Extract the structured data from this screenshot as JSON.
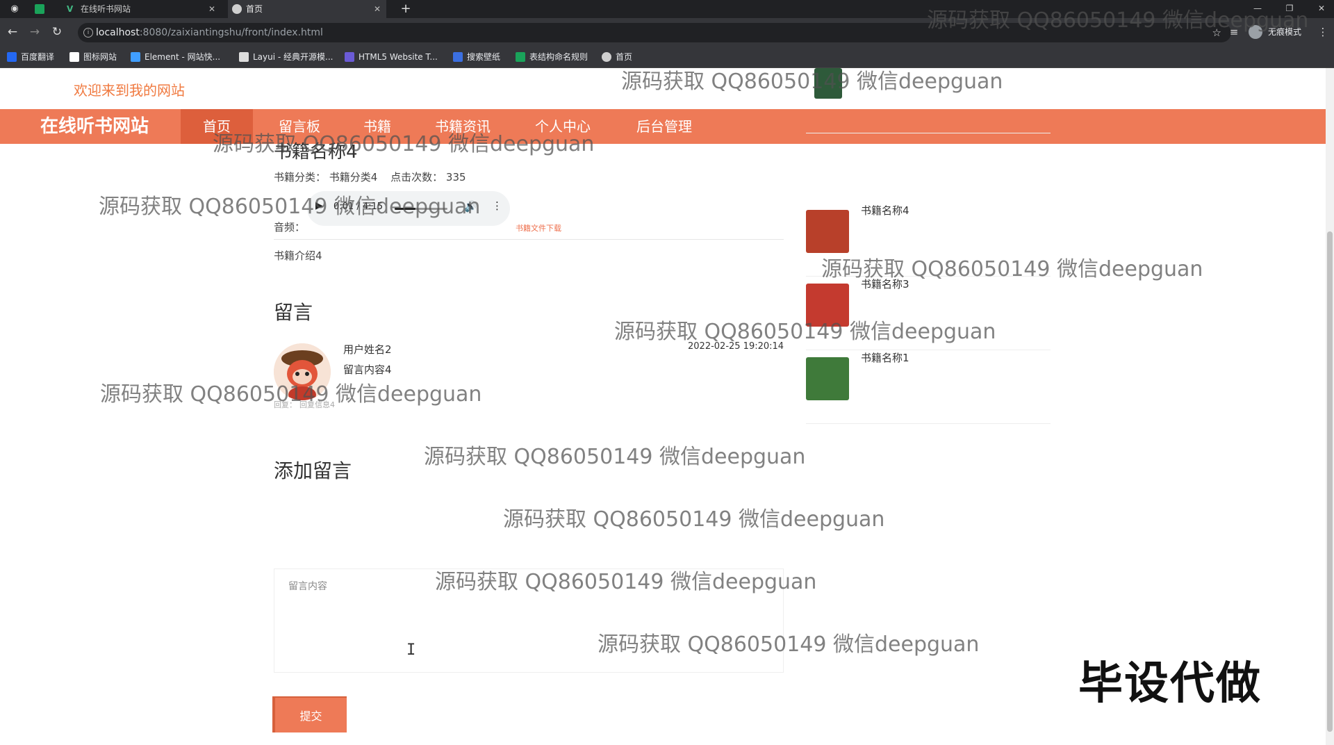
{
  "browser": {
    "tabs": [
      {
        "title": "在线听书网站",
        "icon_color": "#1aa35a"
      },
      {
        "title": "首页",
        "icon_color": "#cfcfcf"
      }
    ],
    "url_host": "localhost",
    "url_path": ":8080/zaixiantingshu/front/index.html",
    "incognito_label": "无痕模式",
    "bookmarks": [
      {
        "label": "百度翻译",
        "color": "#2468f2"
      },
      {
        "label": "图标网站",
        "color": "#ffffff"
      },
      {
        "label": "Element - 网站快...",
        "color": "#409eff"
      },
      {
        "label": "Layui - 经典开源模...",
        "color": "#dddddd"
      },
      {
        "label": "HTML5 Website T...",
        "color": "#6b5bd6"
      },
      {
        "label": "搜索壁纸",
        "color": "#3b6fe0"
      },
      {
        "label": "表结构命名规则",
        "color": "#1aa35a"
      },
      {
        "label": "首页",
        "color": "#cfcfcf"
      }
    ]
  },
  "site": {
    "welcome": "欢迎来到我的网站",
    "logo": "在线听书网站",
    "nav": [
      "首页",
      "留言板",
      "书籍",
      "书籍资讯",
      "个人中心",
      "后台管理"
    ],
    "accent": "#ee7a57"
  },
  "book": {
    "title": "书籍名称4",
    "category_label": "书籍分类：",
    "category": "书籍分类4",
    "clicks_label": "点击次数：",
    "clicks": "335",
    "audio_label": "音频：",
    "audio_time": "0:01 / 4:15",
    "audio_progress_pct": 0.4,
    "download_label": "书籍文件下载",
    "intro": "书籍介绍4"
  },
  "comments": {
    "heading": "留言",
    "items": [
      {
        "user": "用户姓名2",
        "content": "留言内容4",
        "time": "2022-02-25 19:20:14",
        "reply_label": "回复：",
        "reply": "回复信息4"
      }
    ]
  },
  "add_comment": {
    "heading": "添加留言",
    "placeholder": "留言内容",
    "submit_label": "提交"
  },
  "sidebar": {
    "books": [
      {
        "name": "",
        "color": "#2e5a3a"
      },
      {
        "name": "书籍名称4",
        "color": "#b8402a"
      },
      {
        "name": "书籍名称3",
        "color": "#c43a2f"
      },
      {
        "name": "书籍名称1",
        "color": "#3f7a3a"
      }
    ]
  },
  "watermark": "源码获取 QQ86050149 微信deepguan",
  "overlay_text": "毕设代做"
}
